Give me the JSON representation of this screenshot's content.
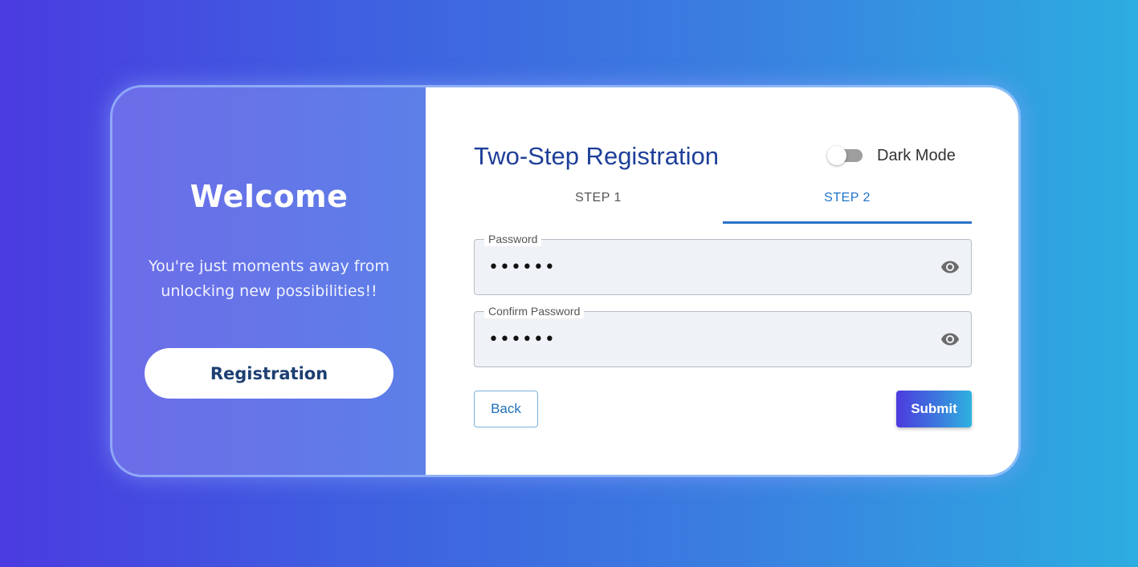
{
  "colors": {
    "brand_gradient_start": "#4a3be0",
    "brand_gradient_end": "#2cade0",
    "title": "#1e3f99",
    "active_tab": "#1e73c8"
  },
  "welcome": {
    "heading": "Welcome",
    "message": "You're just moments away from unlocking new possibilities!!",
    "registration_button": "Registration"
  },
  "form": {
    "title": "Two-Step Registration",
    "dark_mode": {
      "label": "Dark Mode",
      "enabled": false
    },
    "tabs": [
      {
        "label": "STEP 1",
        "active": false
      },
      {
        "label": "STEP 2",
        "active": true
      }
    ],
    "fields": {
      "password": {
        "label": "Password",
        "value": "••••••",
        "icon": "eye-icon"
      },
      "confirm_password": {
        "label": "Confirm Password",
        "value": "••••••",
        "icon": "eye-icon"
      }
    },
    "back_button": "Back",
    "submit_button": "Submit"
  }
}
